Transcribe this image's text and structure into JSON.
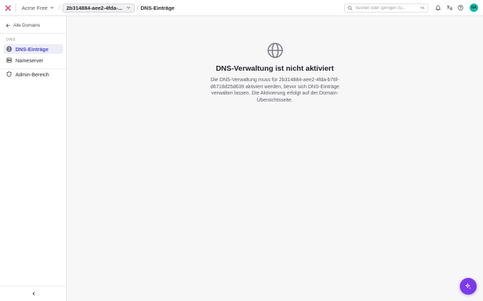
{
  "topbar": {
    "org_name": "Acme Free",
    "domain_selector": "2b314884-aee2-4fda-...",
    "breadcrumb_current": "DNS-Einträge",
    "search_placeholder": "Suchen oder springen zu...",
    "search_shortcut": "⌘K",
    "avatar_initials": "DA"
  },
  "sidebar": {
    "back_label": "Alle Domains",
    "section_label": "DNS",
    "items": [
      {
        "label": "DNS-Einträge",
        "icon": "globe-icon",
        "active": true
      },
      {
        "label": "Nameserver",
        "icon": "server-icon",
        "active": false
      },
      {
        "label": "Admin-Bereich",
        "icon": "shield-icon",
        "active": false
      }
    ]
  },
  "main": {
    "title": "DNS-Verwaltung ist nicht aktiviert",
    "description": "Die DNS-Verwaltung muss für 2b314884-aee2-4fda-b76f-d6718d25d639 aktiviert werden, bevor sich DNS-Einträge verwalten lassen. Die Aktivierung erfolgt auf der Domain-Übersichtsseite."
  },
  "colors": {
    "accent": "#4b47c9",
    "fab": "#7c3aed",
    "avatar": "#17b8a6"
  }
}
